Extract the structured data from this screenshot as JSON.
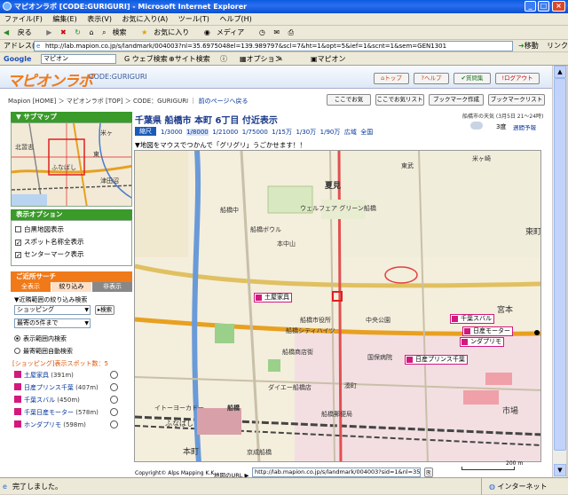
{
  "window": {
    "title": "マピオンラボ [CODE:GURIGURI] - Microsoft Internet Explorer"
  },
  "menu": [
    "ファイル(F)",
    "編集(E)",
    "表示(V)",
    "お気に入り(A)",
    "ツール(T)",
    "ヘルプ(H)"
  ],
  "toolbar": {
    "back": "戻る",
    "search": "検索",
    "favorites": "お気に入り",
    "media": "メディア"
  },
  "address": {
    "label": "アドレス(D)",
    "url": "http://lab.mapion.co.jp/s/landmark/004003?nl=35.6975048el=139.989797&scl=7&ht=1&opt=5&ief=1&scnt=1&sem=GEN1301",
    "go": "移動",
    "links": "リンク"
  },
  "google": {
    "label": "Google",
    "query": "マピオン",
    "web_search": "ウェブ検索",
    "site_search": "サイト検索",
    "options": "オプション",
    "mapion": "マピオン"
  },
  "header": {
    "logo": "マピオンラボ",
    "code": "CODE:GURIGURI",
    "buttons": [
      "トップ",
      "ヘルプ",
      "質問集",
      "ログアウト"
    ]
  },
  "breadcrumb": {
    "text": "Mapion [HOME] ＞ マピオンラボ [TOP] ＞ CODE：GURIGURI",
    "back": "前のページへ戻る"
  },
  "actions": [
    "ここでお気",
    "ここでお気リスト",
    "ブックマーク作成",
    "ブックマークリスト"
  ],
  "location": {
    "title": "千葉県 船橋市 本町 6丁目 付近表示",
    "weather": "船橋市の天気 (3月5日 21～24時)",
    "temp": "3度",
    "weather_link": "週間予報"
  },
  "scale": {
    "label": "縮尺",
    "options": [
      "1/3000",
      "1/8000",
      "1/21000",
      "1/75000",
      "1/15万",
      "1/30万",
      "1/90万",
      "広域",
      "全国"
    ]
  },
  "hint": "▼地図をマウスでつかんで「グリグリ」うごかせます！！",
  "submap": {
    "title": "▼ サブマップ",
    "labels": [
      "柏",
      "米ヶ",
      "船",
      "北習志",
      "東",
      "津田沼",
      "ふなばし"
    ]
  },
  "display_options": {
    "title": "表示オプション",
    "items": [
      {
        "label": "白黒地図表示",
        "checked": false
      },
      {
        "label": "スポット名称全表示",
        "checked": true
      },
      {
        "label": "センターマーク表示",
        "checked": true
      }
    ]
  },
  "nearby": {
    "title": "ご近所サーチ",
    "tabs": [
      "全表示",
      "絞り込み",
      "非表示"
    ],
    "filter_label": "▼近隣範囲の絞り込み検索",
    "category": "ショッピング",
    "search_btn": "検索",
    "range": "最寄の5件まで",
    "radio": [
      "表示範囲内検索",
      "最寄範囲自動検索"
    ],
    "result_head": "[ショッピング]表示スポット数：5",
    "results": [
      {
        "name": "土屋家具",
        "dist": "(391m)"
      },
      {
        "name": "日産プリンス千葉",
        "dist": "(407m)"
      },
      {
        "name": "千葉スバル",
        "dist": "(450m)"
      },
      {
        "name": "千葉日産モーター",
        "dist": "(578m)"
      },
      {
        "name": "ホンダプリモ",
        "dist": "(598m)"
      }
    ]
  },
  "map": {
    "markers": [
      "土屋家具",
      "千葉スバル",
      "日産モーター",
      "ンダプリモ",
      "日産プリンス千葉"
    ],
    "labels": [
      "夏見",
      "船橋中",
      "船橋市役所",
      "船橋シティハイツ",
      "ダイエー船橋店",
      "船橋",
      "イトーヨーカドー",
      "本町",
      "ふなばし",
      "京成船橋",
      "東武",
      "市場",
      "東町",
      "宮本",
      "船橋商店街",
      "国保病院",
      "湊町",
      "中央公園",
      "船橋ボウル",
      "本中山",
      "船橋郵便局",
      "ウェルフェア グリーン船橋",
      "米ヶ崎"
    ]
  },
  "footer": {
    "copyright": "Copyright© Alps Mapping K.K.",
    "url_label": "地図のURL ▶",
    "url": "http://lab.mapion.co.jp/s/landmark/004003?sid=1&nl=35.70270",
    "scale": "200 m"
  },
  "status": {
    "text": "完了しました。",
    "zone": "インターネット"
  },
  "colors": {
    "xp_blue": "#0a5ce0",
    "accent_green": "#3a9a2a",
    "orange": "#f07a1a",
    "marker_pink": "#d4187e",
    "link": "#003399"
  }
}
